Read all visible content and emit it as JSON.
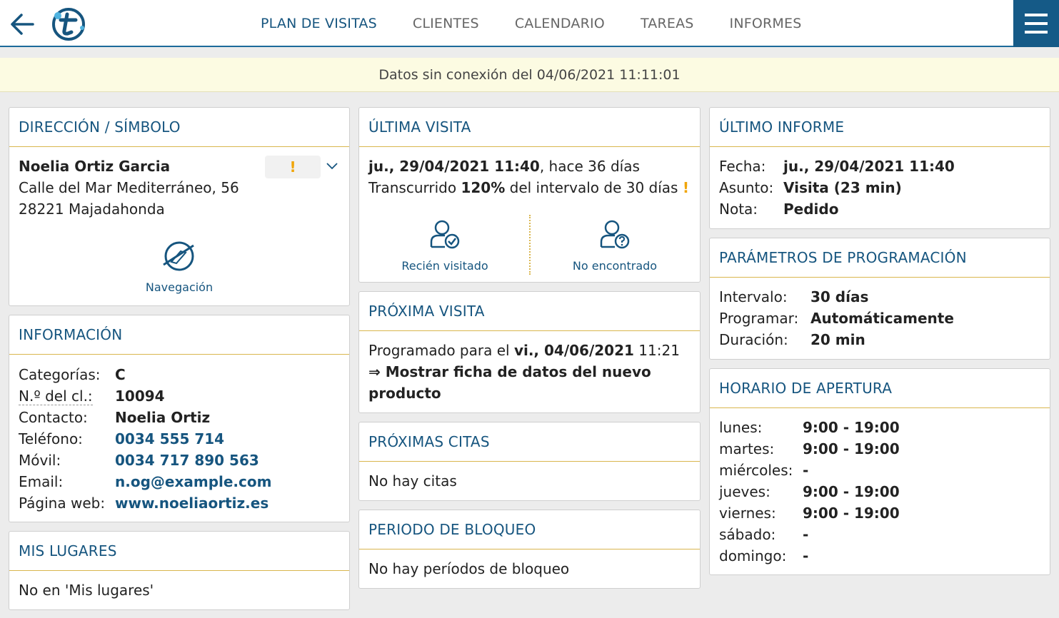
{
  "nav": {
    "tabs": [
      {
        "label": "PLAN DE VISITAS"
      },
      {
        "label": "CLIENTES"
      },
      {
        "label": "CALENDARIO"
      },
      {
        "label": "TAREAS"
      },
      {
        "label": "INFORMES"
      }
    ]
  },
  "banner": {
    "text": "Datos sin conexión del 04/06/2021 11:11:01"
  },
  "address": {
    "title": "DIRECCIÓN / SÍMBOLO",
    "name": "Noelia Ortiz Garcia",
    "street": "Calle del Mar Mediterráneo, 56",
    "city": "28221 Majadahonda",
    "symbol": "!",
    "nav_label": "Navegación"
  },
  "info": {
    "title": "INFORMACIÓN",
    "labels": {
      "categories": "Categorías:",
      "client_no": "N.º del cl.:",
      "contact": "Contacto:",
      "phone": "Teléfono:",
      "mobile": "Móvil:",
      "email": "Email:",
      "web": "Página web:"
    },
    "values": {
      "categories": "C",
      "client_no": "10094",
      "contact": "Noelia Ortiz",
      "phone": "0034 555 714",
      "mobile": "0034 717 890 563",
      "email": "n.og@example.com",
      "web": "www.noeliaortiz.es"
    }
  },
  "places": {
    "title": "MIS LUGARES",
    "text": "No en 'Mis lugares'"
  },
  "last_visit": {
    "title": "ÚLTIMA VISITA",
    "date": "ju., 29/04/2021 11:40",
    "ago": ", hace 36 días",
    "elapsed_pre": "Transcurrido ",
    "elapsed_pct": "120%",
    "elapsed_post": " del intervalo de 30 días ",
    "warn": "!",
    "btn_visited": "Recién visitado",
    "btn_not_found": "No encontrado"
  },
  "next_visit": {
    "title": "PRÓXIMA VISITA",
    "pre": "Programado para el ",
    "date": "vi., 04/06/2021",
    "time": " 11:21",
    "note": "⇒ Mostrar ficha de datos del nuevo producto"
  },
  "appointments": {
    "title": "PRÓXIMAS CITAS",
    "text": "No hay citas"
  },
  "block": {
    "title": "PERIODO DE BLOQUEO",
    "text": "No hay períodos de bloqueo"
  },
  "last_report": {
    "title": "ÚLTIMO INFORME",
    "rows": [
      {
        "label": "Fecha:",
        "value": "ju., 29/04/2021 11:40"
      },
      {
        "label": "Asunto:",
        "value": "Visita (23 min)"
      },
      {
        "label": "Nota:",
        "value": "Pedido"
      }
    ]
  },
  "params": {
    "title": "PARÁMETROS DE PROGRAMACIÓN",
    "rows": [
      {
        "label": "Intervalo:",
        "value": "30 días"
      },
      {
        "label": "Programar:",
        "value": "Automáticamente"
      },
      {
        "label": "Duración:",
        "value": "20 min"
      }
    ]
  },
  "hours": {
    "title": "HORARIO DE APERTURA",
    "rows": [
      {
        "label": "lunes:",
        "value": "9:00 - 19:00"
      },
      {
        "label": "martes:",
        "value": "9:00 - 19:00"
      },
      {
        "label": "miércoles:",
        "value": "-"
      },
      {
        "label": "jueves:",
        "value": "9:00 - 19:00"
      },
      {
        "label": "viernes:",
        "value": "9:00 - 19:00"
      },
      {
        "label": "sábado:",
        "value": "-"
      },
      {
        "label": "domingo:",
        "value": "-"
      }
    ]
  },
  "colors": {
    "primary": "#16557f",
    "accent": "#d9b64e",
    "warning": "#f0a50a",
    "banner": "#fcfbe2"
  }
}
